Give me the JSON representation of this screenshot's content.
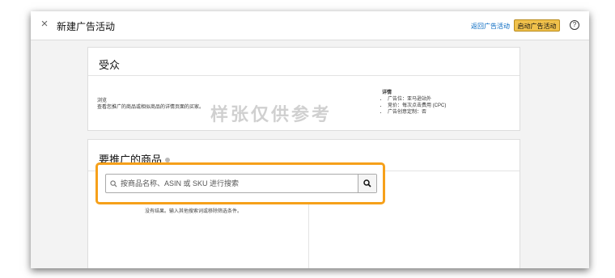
{
  "header": {
    "close_symbol": "×",
    "title": "新建广告活动",
    "back_link": "返回广告活动",
    "launch_button": "启动广告活动",
    "help_symbol": "?"
  },
  "audience": {
    "title": "受众",
    "browse_label": "浏览",
    "browse_desc": "查看您推广的商品或相似商品的详情页面的买家。",
    "details_title": "详情",
    "details": [
      "广告位：亚马逊站外",
      "竞价：每次点击费用 (CPC)",
      "广告创意定制：否"
    ]
  },
  "products": {
    "title": "要推广的商品",
    "search_placeholder": "按商品名称、ASIN 或 SKU 进行搜索",
    "empty_message": "没有结果。输入其他搜索词或移除筛选条件。"
  },
  "watermark": "样张仅供参考",
  "colors": {
    "accent_orange": "#f6a01a",
    "button_yellow": "#f0c14b",
    "link_blue": "#0066c0"
  },
  "icons": {
    "close": "close-icon",
    "help": "help-icon",
    "info": "info-icon",
    "search": "search-icon"
  }
}
